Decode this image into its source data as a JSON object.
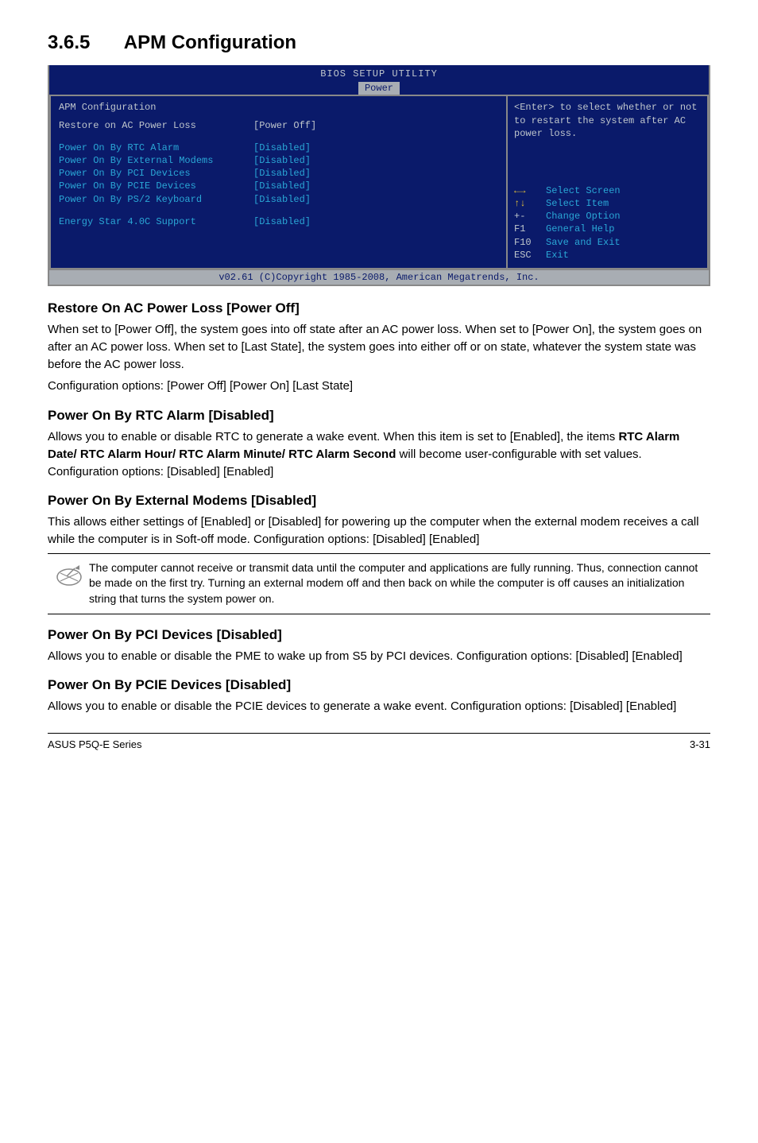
{
  "section": {
    "number": "3.6.5",
    "title": "APM Configuration"
  },
  "bios": {
    "title": "BIOS SETUP UTILITY",
    "tab": "Power",
    "heading": "APM Configuration",
    "rows": [
      {
        "label": "Restore on AC Power Loss",
        "value": "[Power Off]",
        "selected": true
      },
      {
        "spacer": true
      },
      {
        "label": "Power On By RTC Alarm",
        "value": "[Disabled]"
      },
      {
        "label": "Power On By External Modems",
        "value": "[Disabled]"
      },
      {
        "label": "Power On By PCI Devices",
        "value": "[Disabled]"
      },
      {
        "label": "Power On By PCIE Devices",
        "value": "[Disabled]"
      },
      {
        "label": "Power On By PS/2 Keyboard",
        "value": "[Disabled]"
      },
      {
        "spacer": true
      },
      {
        "label": "Energy Star 4.0C Support",
        "value": "[Disabled]"
      }
    ],
    "help_top": "<Enter> to select whether or not to restart the system after AC power loss.",
    "help_keys": [
      {
        "k": "←→",
        "d": "Select Screen",
        "arrow": true
      },
      {
        "k": "↑↓",
        "d": "Select Item",
        "arrow": true
      },
      {
        "k": "+-",
        "d": "Change Option"
      },
      {
        "k": "F1",
        "d": "General Help"
      },
      {
        "k": "F10",
        "d": "Save and Exit"
      },
      {
        "k": "ESC",
        "d": "Exit"
      }
    ],
    "footer": "v02.61 (C)Copyright 1985-2008, American Megatrends, Inc."
  },
  "sections": {
    "s1": {
      "h": "Restore On AC Power Loss [Power Off]",
      "p1": "When set to [Power Off], the system goes into off state after an AC power loss. When set to [Power On], the system goes on after an AC power loss. When set to [Last State], the system goes into either off or on state, whatever the system state was before the AC power loss.",
      "p2": "Configuration options: [Power Off] [Power On] [Last State]"
    },
    "s2": {
      "h": "Power On By RTC Alarm [Disabled]",
      "p1a": "Allows you to enable or disable RTC to generate a wake event. When this item is set to [Enabled], the items ",
      "p1b": "RTC Alarm Date/ RTC Alarm Hour/ RTC Alarm Minute/ RTC Alarm Second",
      "p1c": " will become user-configurable with set values. Configuration options: [Disabled] [Enabled]"
    },
    "s3": {
      "h": "Power On By External Modems [Disabled]",
      "p1": "This allows either settings of [Enabled] or [Disabled] for powering up the computer when the external modem receives a call while the computer is in Soft-off mode. Configuration options: [Disabled] [Enabled]"
    },
    "note": "The computer cannot receive or transmit data until the computer and applications are fully running. Thus, connection cannot be made on the first try. Turning an external modem off and then back on while the computer is off causes an initialization string that turns the system power on.",
    "s4": {
      "h": "Power On By PCI Devices [Disabled]",
      "p1": "Allows you to enable or disable the PME to wake up from S5 by PCI devices. Configuration options: [Disabled] [Enabled]"
    },
    "s5": {
      "h": "Power On By PCIE Devices [Disabled]",
      "p1": "Allows you to enable or disable the PCIE devices to generate a wake event. Configuration options: [Disabled] [Enabled]"
    }
  },
  "footer": {
    "left": "ASUS P5Q-E Series",
    "right": "3-31"
  }
}
